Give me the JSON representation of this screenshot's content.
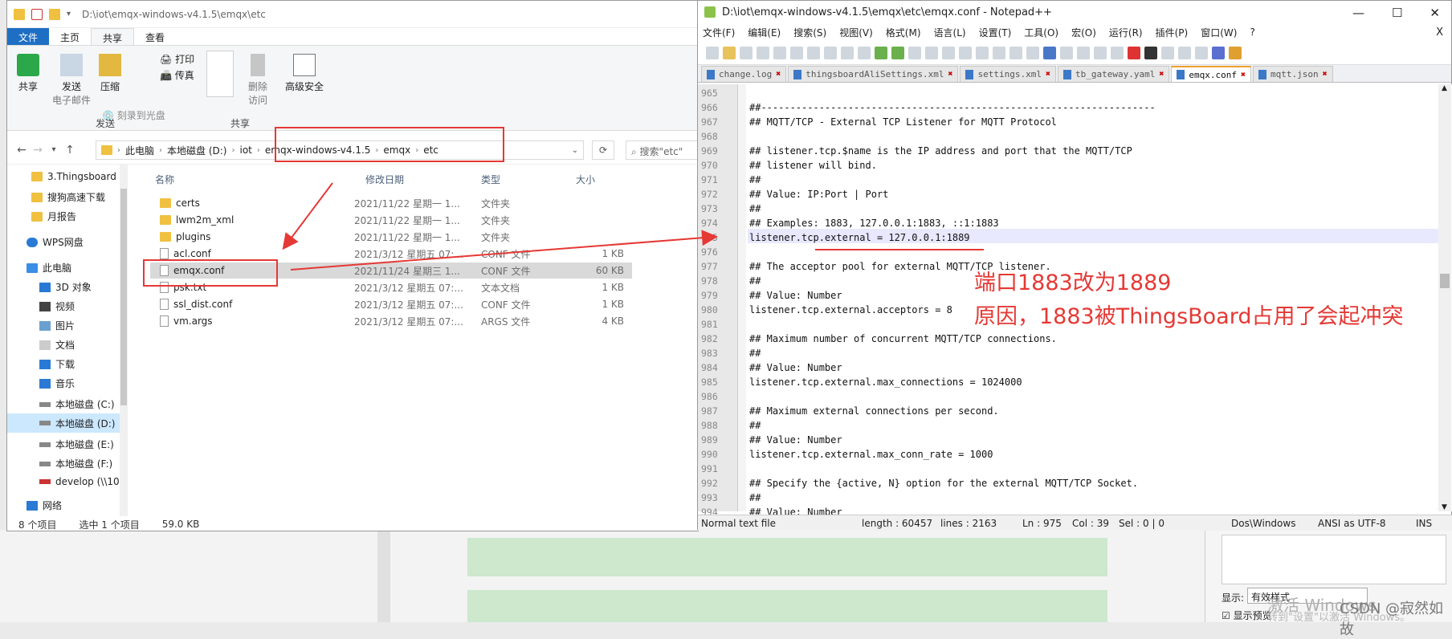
{
  "explorer": {
    "title_path": "D:\\iot\\emqx-windows-v4.1.5\\emqx\\etc",
    "tabs": [
      "文件",
      "主页",
      "共享",
      "查看"
    ],
    "ribbon": {
      "share": "共享",
      "email_1": "发送",
      "email_2": "电子邮件",
      "zip": "压缩",
      "print": "打印",
      "fax": "传真",
      "burn": "刻录到光盘",
      "remove_1": "删除",
      "remove_2": "访问",
      "advanced": "高级安全",
      "group_send": "发送",
      "group_share": "共享"
    },
    "breadcrumb": [
      "此电脑",
      "本地磁盘 (D:)",
      "iot",
      "emqx-windows-v4.1.5",
      "emqx",
      "etc"
    ],
    "search_placeholder": "搜索\"etc\"",
    "nav": [
      "3.Thingsboard",
      "搜狗高速下载",
      "月报告",
      "WPS网盘",
      "此电脑",
      "3D 对象",
      "视频",
      "图片",
      "文档",
      "下载",
      "音乐",
      "本地磁盘 (C:)",
      "本地磁盘 (D:)",
      "本地磁盘 (E:)",
      "本地磁盘 (F:)",
      "develop (\\\\10.1",
      "网络"
    ],
    "columns": {
      "name": "名称",
      "date": "修改日期",
      "type": "类型",
      "size": "大小"
    },
    "files": [
      {
        "name": "certs",
        "date": "2021/11/22 星期一 1...",
        "type": "文件夹",
        "size": ""
      },
      {
        "name": "lwm2m_xml",
        "date": "2021/11/22 星期一 1...",
        "type": "文件夹",
        "size": ""
      },
      {
        "name": "plugins",
        "date": "2021/11/22 星期一 1...",
        "type": "文件夹",
        "size": ""
      },
      {
        "name": "acl.conf",
        "date": "2021/3/12 星期五 07:...",
        "type": "CONF 文件",
        "size": "1 KB"
      },
      {
        "name": "emqx.conf",
        "date": "2021/11/24 星期三 1...",
        "type": "CONF 文件",
        "size": "60 KB"
      },
      {
        "name": "psk.txt",
        "date": "2021/3/12 星期五 07:...",
        "type": "文本文档",
        "size": "1 KB"
      },
      {
        "name": "ssl_dist.conf",
        "date": "2021/3/12 星期五 07:...",
        "type": "CONF 文件",
        "size": "1 KB"
      },
      {
        "name": "vm.args",
        "date": "2021/3/12 星期五 07:...",
        "type": "ARGS 文件",
        "size": "4 KB"
      }
    ],
    "status": {
      "count": "8 个项目",
      "selected": "选中 1 个项目",
      "size": "59.0 KB"
    }
  },
  "notepad": {
    "title": "D:\\iot\\emqx-windows-v4.1.5\\emqx\\etc\\emqx.conf - Notepad++",
    "menu": [
      "文件(F)",
      "编辑(E)",
      "搜索(S)",
      "视图(V)",
      "格式(M)",
      "语言(L)",
      "设置(T)",
      "工具(O)",
      "宏(O)",
      "运行(R)",
      "插件(P)",
      "窗口(W)",
      "?"
    ],
    "close_x": "X",
    "tabs": [
      "change.log",
      "thingsboardAliSettings.xml",
      "settings.xml",
      "tb_gateway.yaml",
      "emqx.conf",
      "mqtt.json"
    ],
    "lines": [
      {
        "n": "965",
        "t": ""
      },
      {
        "n": "966",
        "t": "##--------------------------------------------------------------------"
      },
      {
        "n": "967",
        "t": "## MQTT/TCP - External TCP Listener for MQTT Protocol"
      },
      {
        "n": "968",
        "t": ""
      },
      {
        "n": "969",
        "t": "## listener.tcp.$name is the IP address and port that the MQTT/TCP"
      },
      {
        "n": "970",
        "t": "## listener will bind."
      },
      {
        "n": "971",
        "t": "##"
      },
      {
        "n": "972",
        "t": "## Value: IP:Port | Port"
      },
      {
        "n": "973",
        "t": "##"
      },
      {
        "n": "974",
        "t": "## Examples: 1883, 127.0.0.1:1883, ::1:1883"
      },
      {
        "n": "975",
        "t": "listener.tcp.external = 127.0.0.1:1889"
      },
      {
        "n": "976",
        "t": ""
      },
      {
        "n": "977",
        "t": "## The acceptor pool for external MQTT/TCP listener."
      },
      {
        "n": "978",
        "t": "##"
      },
      {
        "n": "979",
        "t": "## Value: Number"
      },
      {
        "n": "980",
        "t": "listener.tcp.external.acceptors = 8"
      },
      {
        "n": "981",
        "t": ""
      },
      {
        "n": "982",
        "t": "## Maximum number of concurrent MQTT/TCP connections."
      },
      {
        "n": "983",
        "t": "##"
      },
      {
        "n": "984",
        "t": "## Value: Number"
      },
      {
        "n": "985",
        "t": "listener.tcp.external.max_connections = 1024000"
      },
      {
        "n": "986",
        "t": ""
      },
      {
        "n": "987",
        "t": "## Maximum external connections per second."
      },
      {
        "n": "988",
        "t": "##"
      },
      {
        "n": "989",
        "t": "## Value: Number"
      },
      {
        "n": "990",
        "t": "listener.tcp.external.max_conn_rate = 1000"
      },
      {
        "n": "991",
        "t": ""
      },
      {
        "n": "992",
        "t": "## Specify the {active, N} option for the external MQTT/TCP Socket."
      },
      {
        "n": "993",
        "t": "##"
      },
      {
        "n": "994",
        "t": "## Value: Number"
      }
    ],
    "status": {
      "type": "Normal text file",
      "length": "length : 60457",
      "lines": "lines : 2163",
      "ln": "Ln : 975",
      "col": "Col : 39",
      "sel": "Sel : 0 | 0",
      "eol": "Dos\\Windows",
      "enc": "ANSI as UTF-8",
      "ins": "INS"
    }
  },
  "annotation": {
    "line1": "端口1883改为1889",
    "line2": "原因，1883被ThingsBoard占用了会起冲突"
  },
  "background": {
    "display_label": "显示:",
    "display_value": "有效样式",
    "preview": "显示预览",
    "watermark": "激活 Windows",
    "watermark2": "转到\"设置\"以激活 Windows。",
    "csdn": "CSDN @寂然如故"
  },
  "colors": {
    "accent": "#1e6fc4",
    "annotation": "#e53935",
    "selection": "#d9d9d9"
  }
}
